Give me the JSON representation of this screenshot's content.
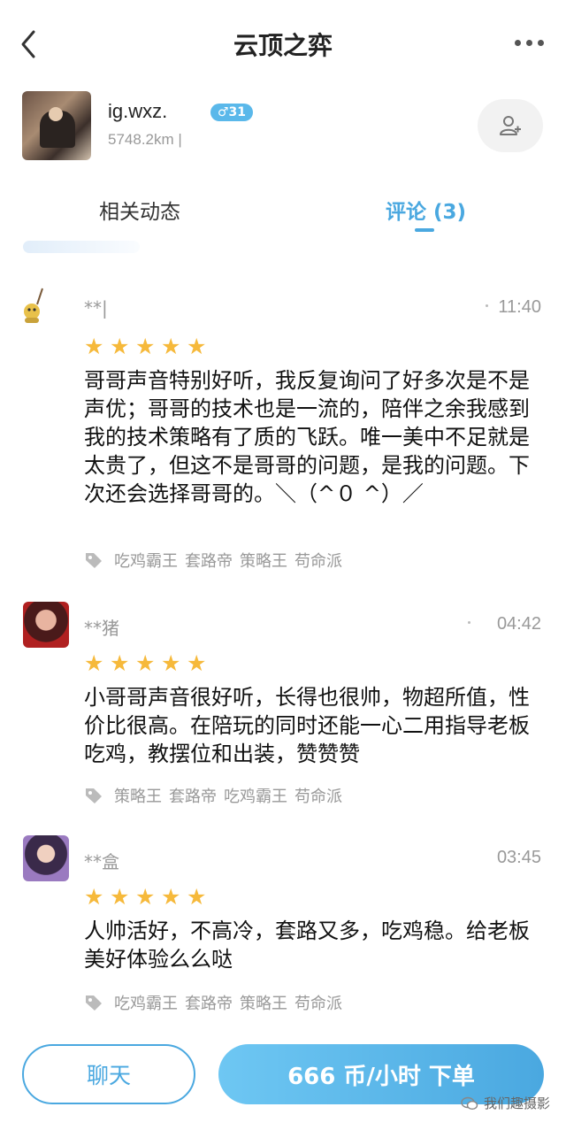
{
  "nav": {
    "title": "云顶之弈"
  },
  "profile": {
    "name": "ig.wxz.",
    "badge": "♂31",
    "distance": "5748.2km |"
  },
  "tabs": [
    {
      "label": "相关动态"
    },
    {
      "label": "评论 (3)"
    }
  ],
  "reviews": [
    {
      "user": "**|",
      "time": "11:40",
      "stars": 5,
      "text": "哥哥声音特别好听，我反复询问了好多次是不是声优；哥哥的技术也是一流的，陪伴之余我感到我的技术策略有了质的飞跃。唯一美中不足就是太贵了，但这不是哥哥的问题，是我的问题。下次还会选择哥哥的。＼（^０ ^）／",
      "tags": [
        "吃鸡霸王",
        "套路帝",
        "策略王",
        "苟命派"
      ]
    },
    {
      "user": "**猪",
      "time": "04:42",
      "stars": 5,
      "text": "小哥哥声音很好听，长得也很帅，物超所值，性价比很高。在陪玩的同时还能一心二用指导老板吃鸡，教摆位和出装，赞赞赞",
      "tags": [
        "策略王",
        "套路帝",
        "吃鸡霸王",
        "苟命派"
      ]
    },
    {
      "user": "**盒",
      "time": "03:45",
      "stars": 5,
      "text": "人帅活好，不高冷，套路又多，吃鸡稳。给老板美好体验么么哒",
      "tags": [
        "吃鸡霸王",
        "套路帝",
        "策略王",
        "苟命派"
      ]
    }
  ],
  "footer": {
    "chat_label": "聊天",
    "order_label": "666 币/小时 下单"
  },
  "watermark": "我们趣摄影",
  "colors": {
    "accent": "#4aa8e0",
    "star": "#f6b93b",
    "muted": "#999999"
  }
}
